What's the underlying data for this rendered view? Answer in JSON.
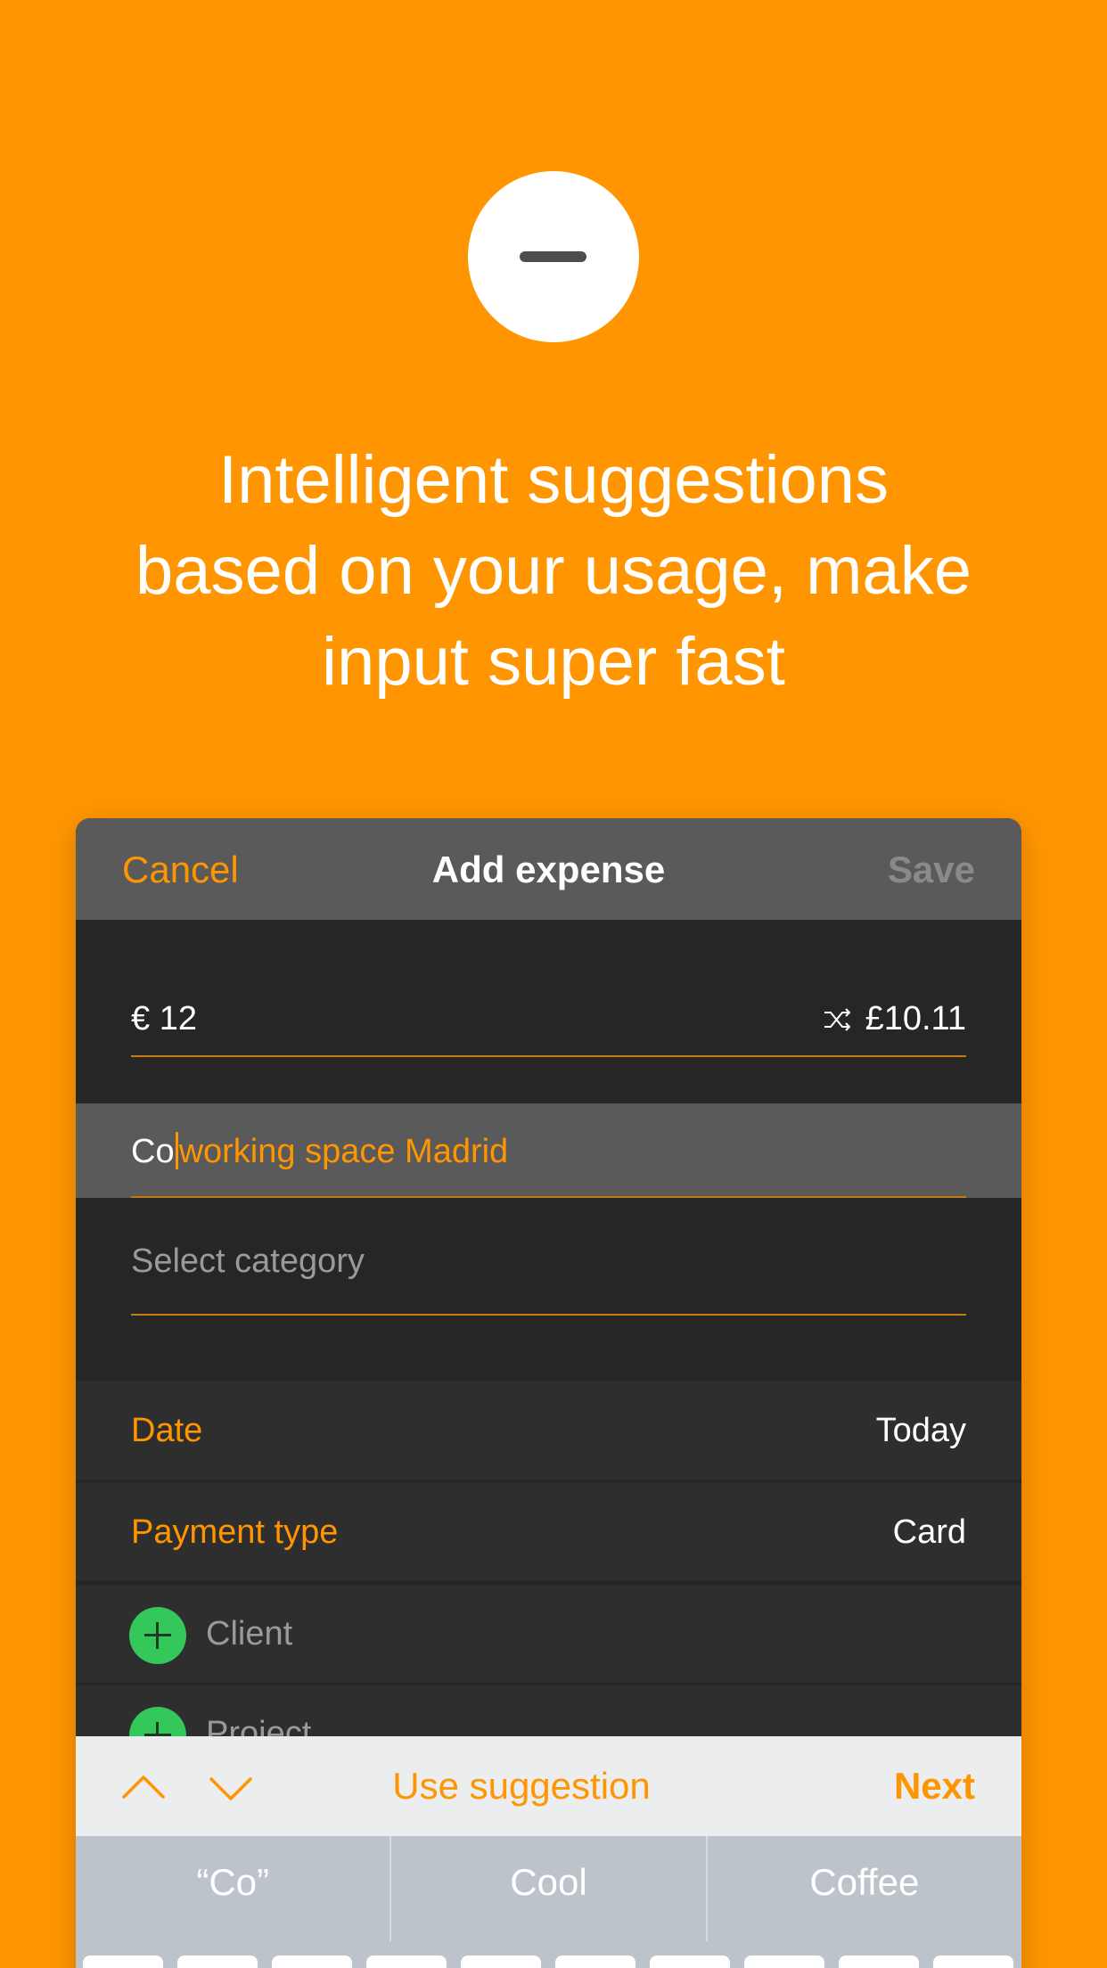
{
  "headline": {
    "line1": "Intelligent suggestions",
    "line2": "based on your usage, make",
    "line3": "input super fast"
  },
  "badge_icon": "minus-icon",
  "navbar": {
    "cancel": "Cancel",
    "title": "Add expense",
    "save": "Save"
  },
  "amount": {
    "value": "€ 12",
    "converted": "£10.11",
    "convert_icon": "shuffle-icon"
  },
  "name_field": {
    "typed": "Co",
    "suggestion": "working space Madrid"
  },
  "category": {
    "placeholder": "Select category"
  },
  "details": [
    {
      "label": "Date",
      "value": "Today"
    },
    {
      "label": "Payment type",
      "value": "Card"
    }
  ],
  "optional": [
    {
      "label": "Client",
      "icon": "plus-circle-icon"
    },
    {
      "label": "Project",
      "icon": "plus-circle-icon"
    }
  ],
  "keyboard_bar": {
    "up_icon": "chevron-up-icon",
    "down_icon": "chevron-down-icon",
    "use_suggestion": "Use suggestion",
    "next": "Next"
  },
  "predictive": [
    "“Co”",
    "Cool",
    "Coffee"
  ],
  "colors": {
    "accent": "#FF9500",
    "background": "#FF9500",
    "panel": "#262626",
    "header": "#5a5a5a",
    "add": "#34C759"
  }
}
